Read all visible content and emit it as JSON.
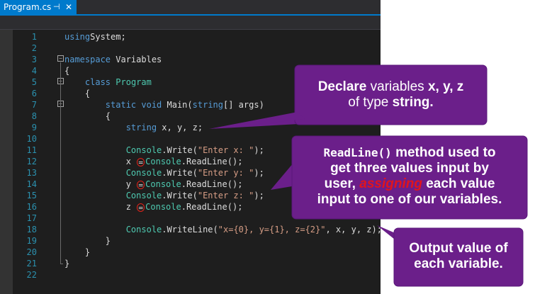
{
  "tab": {
    "title": "Program.cs",
    "pin_icon": "pin-icon",
    "close_icon": "close-icon"
  },
  "code_lines": [
    {
      "n": "1",
      "parts": [
        [
          "kw",
          "using"
        ],
        [
          "",
          "System;"
        ]
      ]
    },
    {
      "n": "2",
      "parts": []
    },
    {
      "n": "3",
      "parts": [
        [
          "kw",
          "namespace"
        ],
        [
          "",
          " Variables"
        ]
      ]
    },
    {
      "n": "4",
      "parts": [
        [
          "",
          "{"
        ]
      ]
    },
    {
      "n": "5",
      "parts": [
        [
          "",
          "    "
        ],
        [
          "kw",
          "class"
        ],
        [
          "",
          " "
        ],
        [
          "ty",
          "Program"
        ]
      ]
    },
    {
      "n": "6",
      "parts": [
        [
          "",
          "    {"
        ]
      ]
    },
    {
      "n": "7",
      "parts": [
        [
          "",
          "        "
        ],
        [
          "kw",
          "static void"
        ],
        [
          "",
          " Main("
        ],
        [
          "kw",
          "string"
        ],
        [
          "",
          "[] args)"
        ]
      ]
    },
    {
      "n": "8",
      "parts": [
        [
          "",
          "        {"
        ]
      ]
    },
    {
      "n": "9",
      "parts": [
        [
          "",
          "            "
        ],
        [
          "kw",
          "string"
        ],
        [
          "",
          " x, y, z;"
        ]
      ]
    },
    {
      "n": "10",
      "parts": []
    },
    {
      "n": "11",
      "parts": [
        [
          "",
          "            "
        ],
        [
          "ty",
          "Console"
        ],
        [
          "",
          ".Write("
        ],
        [
          "st",
          "\"Enter x: \""
        ],
        [
          "",
          ");"
        ]
      ]
    },
    {
      "n": "12",
      "parts": [
        [
          "",
          "            x "
        ],
        [
          "circ",
          "="
        ],
        [
          " ",
          ""
        ],
        [
          "ty",
          "Console"
        ],
        [
          "",
          ".ReadLine();"
        ]
      ]
    },
    {
      "n": "13",
      "parts": [
        [
          "",
          "            "
        ],
        [
          "ty",
          "Console"
        ],
        [
          "",
          ".Write("
        ],
        [
          "st",
          "\"Enter y: \""
        ],
        [
          "",
          ");"
        ]
      ]
    },
    {
      "n": "14",
      "parts": [
        [
          "",
          "            y "
        ],
        [
          "circ",
          "="
        ],
        [
          " ",
          ""
        ],
        [
          "ty",
          "Console"
        ],
        [
          "",
          ".ReadLine();"
        ]
      ]
    },
    {
      "n": "15",
      "parts": [
        [
          "",
          "            "
        ],
        [
          "ty",
          "Console"
        ],
        [
          "",
          ".Write("
        ],
        [
          "st",
          "\"Enter z: \""
        ],
        [
          "",
          ");"
        ]
      ]
    },
    {
      "n": "16",
      "parts": [
        [
          "",
          "            z "
        ],
        [
          "circ",
          "="
        ],
        [
          " ",
          ""
        ],
        [
          "ty",
          "Console"
        ],
        [
          "",
          ".ReadLine();"
        ]
      ]
    },
    {
      "n": "17",
      "parts": []
    },
    {
      "n": "18",
      "parts": [
        [
          "",
          "            "
        ],
        [
          "ty",
          "Console"
        ],
        [
          "",
          ".WriteLine("
        ],
        [
          "st",
          "\"x={0}, y={1}, z={2}\""
        ],
        [
          "",
          ", x, y, z);"
        ]
      ]
    },
    {
      "n": "19",
      "parts": [
        [
          "",
          "        }"
        ]
      ]
    },
    {
      "n": "20",
      "parts": [
        [
          "",
          "    }"
        ]
      ]
    },
    {
      "n": "21",
      "parts": [
        [
          "",
          "}"
        ]
      ]
    },
    {
      "n": "22",
      "parts": []
    }
  ],
  "callouts": {
    "declare": {
      "bold1": "Declare",
      "normal": " variables ",
      "bold2": "x, y, z",
      "line2_normal": "of type ",
      "line2_bold": "string."
    },
    "readline": {
      "code": "ReadLine()",
      "t1": " method used to",
      "t2": "get three values input by",
      "t3a": "user, ",
      "t3red": "assigning",
      "t3b": " each value",
      "t4": "input to one of our variables."
    },
    "output": {
      "l1": "Output value of",
      "l2": "each variable."
    }
  },
  "colors": {
    "callout_fill": "#6b1f8a",
    "callout_border": "#6b1f8a",
    "accent": "#007acc",
    "highlight_red": "#e0141e"
  }
}
